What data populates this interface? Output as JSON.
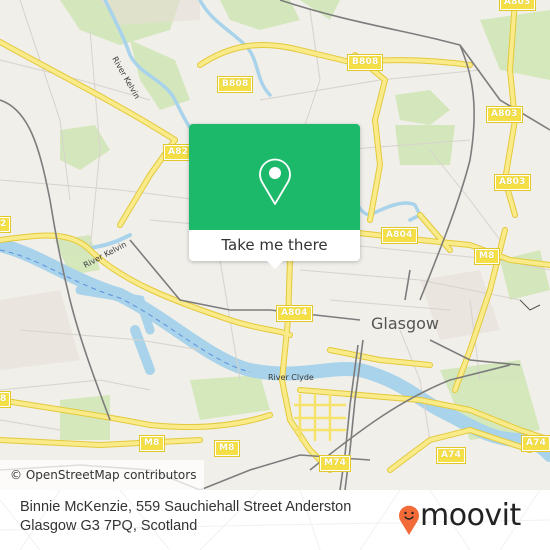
{
  "map": {
    "road_labels": [
      {
        "id": "b808-west",
        "text": "B808"
      },
      {
        "id": "b808-east",
        "text": "B808"
      },
      {
        "id": "a82",
        "text": "A82"
      },
      {
        "id": "a803-top",
        "text": "A803"
      },
      {
        "id": "a803-mid",
        "text": "A803"
      },
      {
        "id": "a803-lower",
        "text": "A803"
      },
      {
        "id": "a804-east",
        "text": "A804"
      },
      {
        "id": "a804-west",
        "text": "A804"
      },
      {
        "id": "m8-east",
        "text": "M8"
      },
      {
        "id": "m8-southwest",
        "text": "M8"
      },
      {
        "id": "m8-south",
        "text": "M8"
      },
      {
        "id": "m74",
        "text": "M74"
      },
      {
        "id": "a74-west",
        "text": "A74"
      },
      {
        "id": "a74-east",
        "text": "A74"
      },
      {
        "id": "a8-edge",
        "text": "8"
      },
      {
        "id": "a82-edge",
        "text": "2"
      }
    ],
    "water_labels": {
      "river_kelvin_north": "River Kelvin",
      "river_kelvin_south": "River Kelvin",
      "river_clyde": "River Clyde"
    },
    "city_label": "Glasgow",
    "attribution": "© OpenStreetMap contributors"
  },
  "popup": {
    "icon": "location-pin-icon",
    "cta_label": "Take me there",
    "accent_color": "#1db96a"
  },
  "footer": {
    "address_line1": "Binnie McKenzie, 559 Sauchiehall Street Anderston",
    "address_line2": "Glasgow G3 7PQ, Scotland",
    "brand": "moovit",
    "brand_color": "#f26a38"
  }
}
